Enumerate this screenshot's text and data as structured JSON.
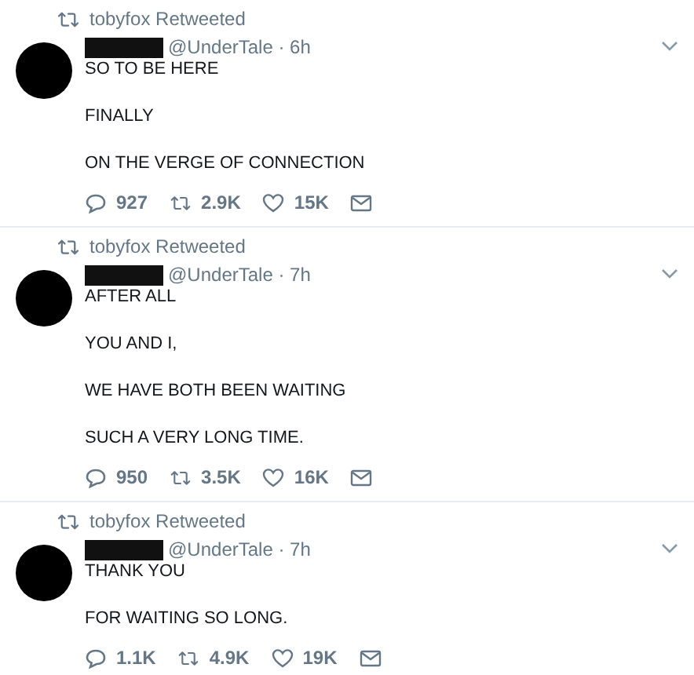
{
  "tweets": [
    {
      "retweeted_by": "tobyfox Retweeted",
      "meta": "@UnderTale · 6h",
      "lines": [
        "SO TO BE HERE",
        "FINALLY",
        "ON THE VERGE OF CONNECTION"
      ],
      "replies": "927",
      "retweets": "2.9K",
      "likes": "15K"
    },
    {
      "retweeted_by": "tobyfox Retweeted",
      "meta": "@UnderTale · 7h",
      "lines": [
        "AFTER ALL",
        "YOU AND I,",
        "WE HAVE BOTH BEEN WAITING",
        "SUCH A VERY LONG TIME."
      ],
      "replies": "950",
      "retweets": "3.5K",
      "likes": "16K"
    },
    {
      "retweeted_by": "tobyfox Retweeted",
      "meta": "@UnderTale · 7h",
      "lines": [
        "THANK YOU",
        "FOR WAITING SO LONG."
      ],
      "replies": "1.1K",
      "retweets": "4.9K",
      "likes": "19K"
    }
  ]
}
